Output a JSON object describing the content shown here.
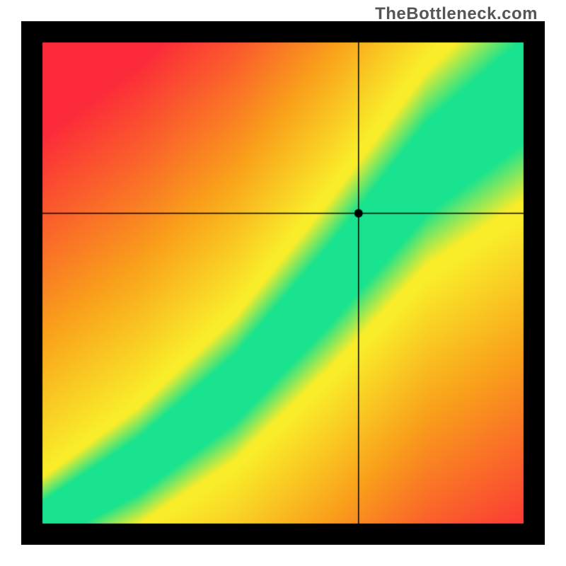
{
  "watermark_text": "TheBottleneck.com",
  "chart_data": {
    "type": "heatmap",
    "title": "",
    "xlabel": "",
    "ylabel": "",
    "xlim": [
      0,
      1
    ],
    "ylim": [
      0,
      1
    ],
    "grid": false,
    "legend": "none",
    "annotations": [],
    "crosshair": {
      "x": 0.657,
      "y": 0.645
    },
    "crosshair_marker_radius_px": 6,
    "border_width_px": 30,
    "border_color": "#000000",
    "ideal_band": {
      "center_points": [
        {
          "x": 0.0,
          "y": 0.0
        },
        {
          "x": 0.2,
          "y": 0.12
        },
        {
          "x": 0.4,
          "y": 0.28
        },
        {
          "x": 0.6,
          "y": 0.5
        },
        {
          "x": 0.8,
          "y": 0.74
        },
        {
          "x": 1.0,
          "y": 0.9
        }
      ],
      "green_halfwidth": 0.045,
      "yellow_halfwidth": 0.11
    },
    "color_stops": {
      "green": "#19e38e",
      "yellow": "#f9ed2a",
      "orange": "#f9a11b",
      "red": "#fc2a3a"
    }
  }
}
